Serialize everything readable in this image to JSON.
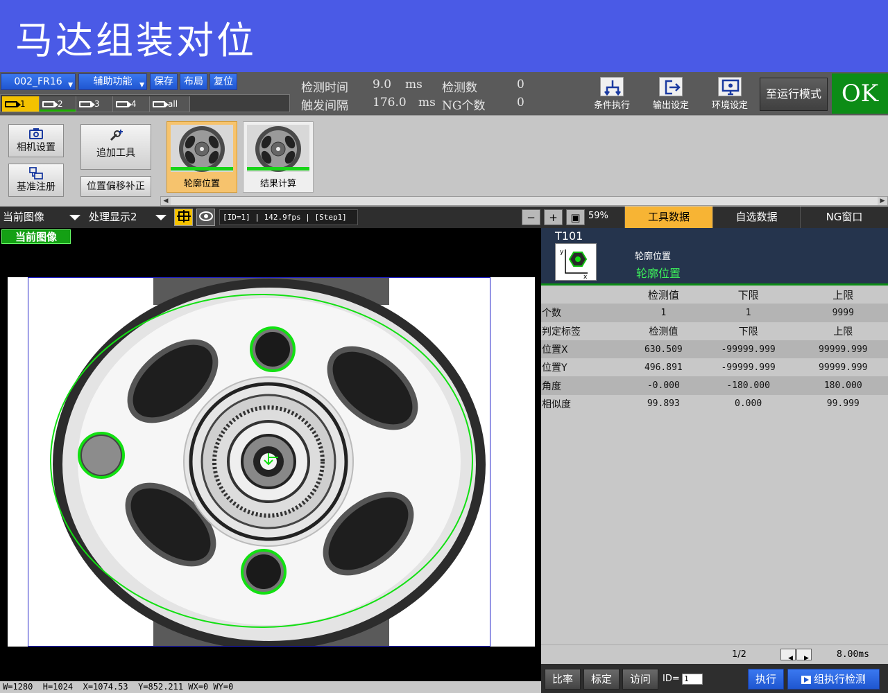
{
  "banner": {
    "title": "马达组装对位"
  },
  "toolbar": {
    "scene": "002_FR16",
    "aux": "辅助功能",
    "save": "保存",
    "layout": "布局",
    "reset": "复位",
    "cam_tabs": [
      "1",
      "2",
      "3",
      "4",
      "all"
    ],
    "stats": {
      "detect_time_label": "检测时间",
      "detect_time_value": "9.0",
      "detect_time_unit": "ms",
      "trigger_interval_label": "触发间隔",
      "trigger_interval_value": "176.0",
      "trigger_interval_unit": "ms",
      "detect_count_label": "检测数",
      "detect_count_value": "0",
      "ng_count_label": "NG个数",
      "ng_count_value": "0"
    },
    "cond_exec": "条件执行",
    "output_settings": "输出设定",
    "env_settings": "环境设定",
    "run_mode": "至运行模式",
    "result": "OK",
    "result_color": "#0c8c16"
  },
  "tools": {
    "camera_settings": "相机设置",
    "ref_register": "基准注册",
    "add_tool": "追加工具",
    "pos_offset": "位置偏移补正",
    "flow": [
      {
        "id": "T101",
        "label": "轮廓位置"
      },
      {
        "id": "T102",
        "label": "结果计算"
      }
    ]
  },
  "viewbar": {
    "image_select": "当前图像",
    "display_select": "处理显示2",
    "info": "[ID=1] | 142.9fps | [Step1]",
    "zoom": "59%"
  },
  "image": {
    "label": "当前图像",
    "status": "W=1280  H=1024  X=1074.53  Y=852.211 WX=0 WY=0"
  },
  "right_tabs": [
    "工具数据",
    "自选数据",
    "NG窗口"
  ],
  "tool_panel": {
    "id": "T101",
    "type_name": "轮廓位置",
    "name": "轮廓位置",
    "header": [
      "",
      "检测值",
      "下限",
      "上限"
    ],
    "rows": [
      [
        "个数",
        "1",
        "1",
        "9999"
      ],
      [
        "判定标签",
        "检测值",
        "下限",
        "上限"
      ],
      [
        "位置X",
        "630.509",
        "-99999.999",
        "99999.999"
      ],
      [
        "位置Y",
        "496.891",
        "-99999.999",
        "99999.999"
      ],
      [
        "角度",
        "-0.000",
        "-180.000",
        "180.000"
      ],
      [
        "相似度",
        "99.893",
        "0.000",
        "99.999"
      ]
    ],
    "page": "1/2",
    "time": "8.00ms"
  },
  "bottom": {
    "ratio": "比率",
    "calib": "标定",
    "access": "访问",
    "id_label": "ID=",
    "id_value": "1",
    "execute": "执行",
    "group_exec": "组执行检测"
  }
}
